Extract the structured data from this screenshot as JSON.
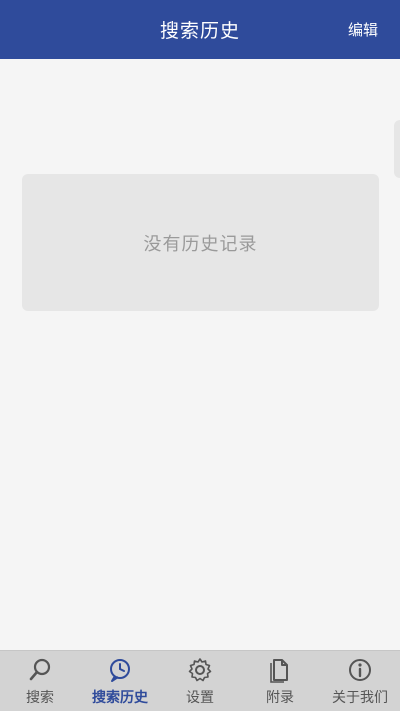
{
  "header": {
    "title": "搜索历史",
    "edit_label": "编辑"
  },
  "empty_state": {
    "message": "没有历史记录"
  },
  "tabbar": {
    "active_index": 1,
    "items": [
      {
        "label": "搜索",
        "icon": "search-icon"
      },
      {
        "label": "搜索历史",
        "icon": "history-icon"
      },
      {
        "label": "设置",
        "icon": "gear-icon"
      },
      {
        "label": "附录",
        "icon": "document-icon"
      },
      {
        "label": "关于我们",
        "icon": "info-icon"
      }
    ]
  },
  "colors": {
    "brand": "#2f4b9b",
    "tabbar_bg": "#d3d3d3",
    "page_bg": "#f5f5f5",
    "empty_card_bg": "#e6e6e6",
    "empty_text": "#9a9a9a",
    "icon_inactive": "#555555"
  }
}
